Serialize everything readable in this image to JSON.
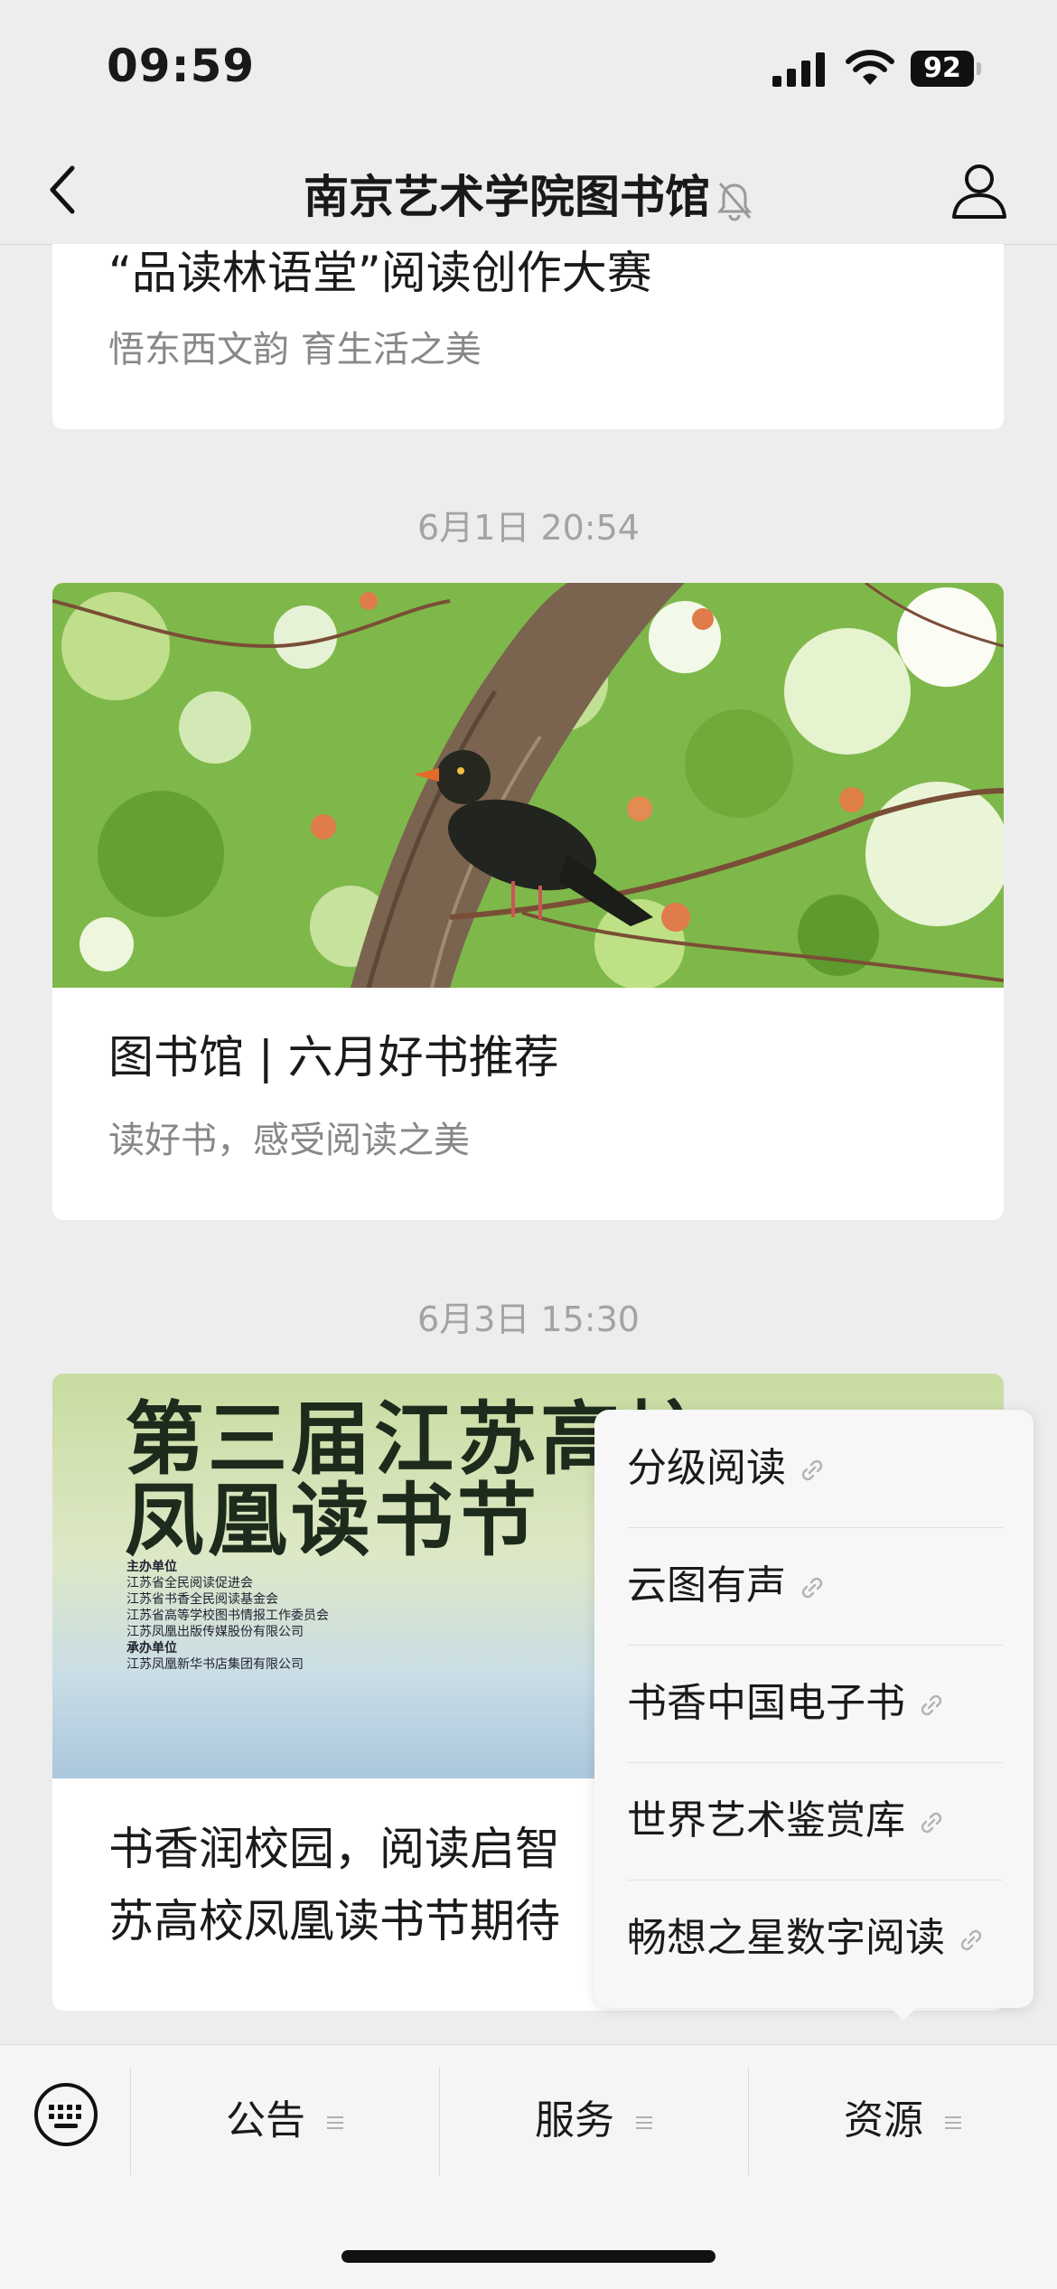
{
  "status_bar": {
    "time": "09:59",
    "battery": "92"
  },
  "navbar": {
    "title": "南京艺术学院图书馆"
  },
  "feed": {
    "card1": {
      "title": "“品读林语堂”阅读创作大赛",
      "subtitle": "悟东西文韵 育生活之美"
    },
    "timestamp2": "6月1日 20:54",
    "card2": {
      "title": "图书馆 | 六月好书推荐",
      "subtitle": "读好书，感受阅读之美"
    },
    "timestamp3": "6月3日 15:30",
    "card3": {
      "poster": {
        "line1": "第三届江苏高校",
        "line2": "凤凰读书节",
        "sponsor_label": "主办单位",
        "sponsors": [
          "江苏省全民阅读促进会",
          "江苏省书香全民阅读基金会",
          "江苏省高等学校图书情报工作委员会",
          "江苏凤凰出版传媒股份有限公司"
        ],
        "organizer_label": "承办单位",
        "organizers": [
          "江苏凤凰新华书店集团有限公司"
        ]
      },
      "title_line1": "书香润校园，阅读启智",
      "title_line2": "苏高校凤凰读书节期待"
    }
  },
  "popup_menu": {
    "items": [
      {
        "label": "分级阅读"
      },
      {
        "label": "云图有声"
      },
      {
        "label": "书香中国电子书"
      },
      {
        "label": "世界艺术鉴赏库"
      },
      {
        "label": "畅想之星数字阅读"
      }
    ]
  },
  "bottom_menu": {
    "tabs": [
      {
        "label": "公告"
      },
      {
        "label": "服务"
      },
      {
        "label": "资源"
      }
    ]
  },
  "icons": {
    "back": "chevron-left-icon",
    "mute": "bell-muted-icon",
    "profile": "person-icon",
    "keyboard": "keyboard-icon",
    "link": "link-icon",
    "menu_lines": "menu-lines-icon"
  }
}
